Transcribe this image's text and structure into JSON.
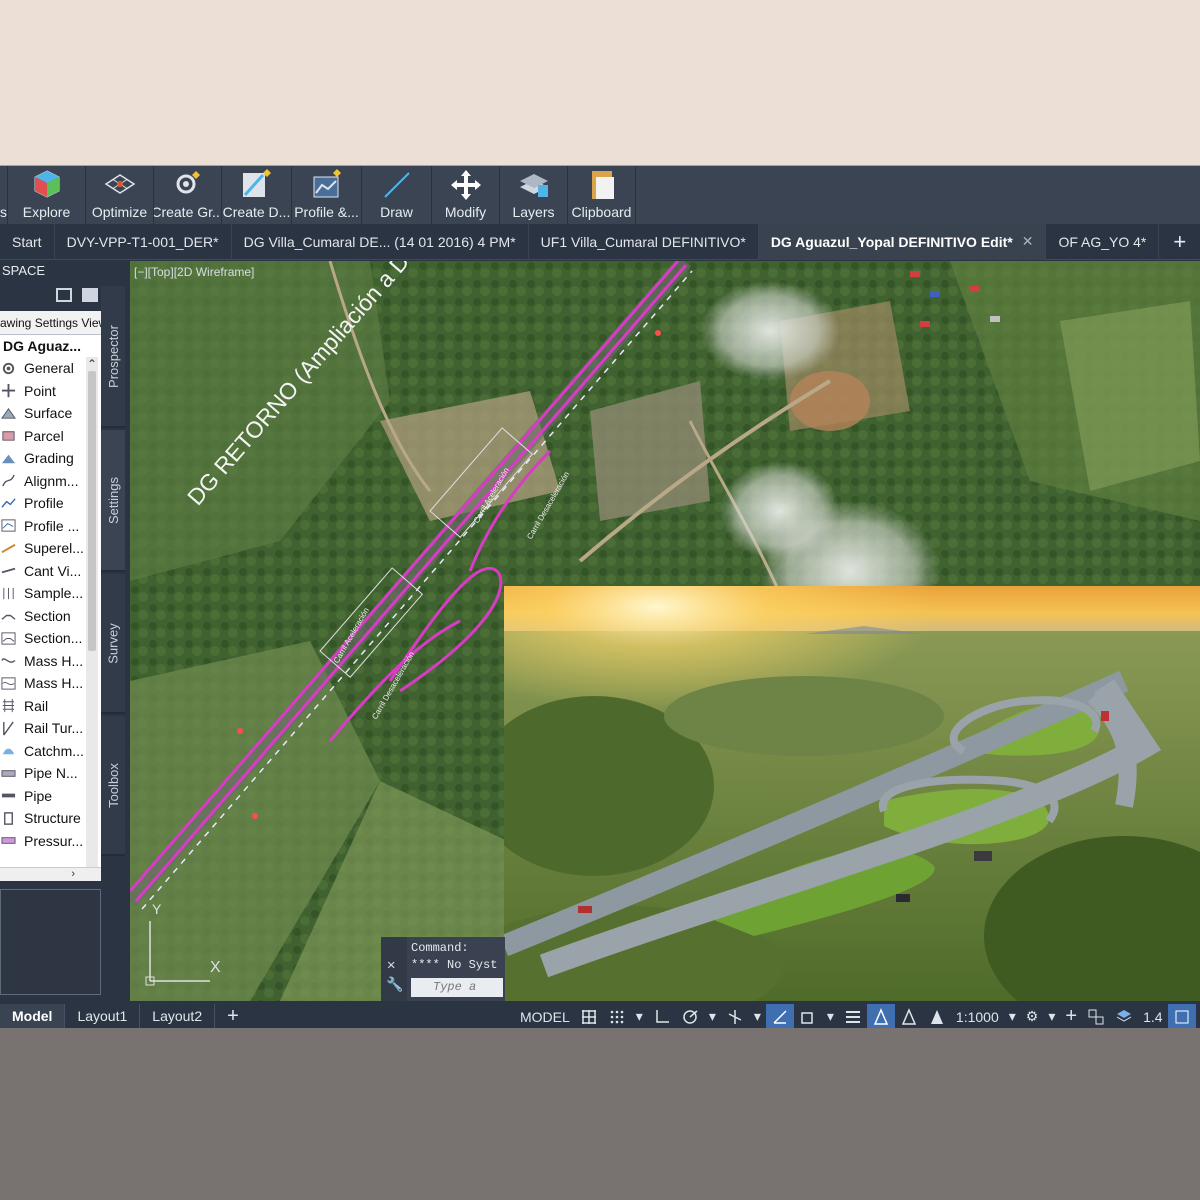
{
  "ribbon": {
    "buttons": [
      {
        "label": "s",
        "icon": "panel-icon"
      },
      {
        "label": "Explore",
        "icon": "cube-icon"
      },
      {
        "label": "Optimize",
        "icon": "grid-optimize-icon"
      },
      {
        "label": "Create Gr...",
        "icon": "grading-create-icon"
      },
      {
        "label": "Create D...",
        "icon": "design-create-icon"
      },
      {
        "label": "Profile &...",
        "icon": "profile-icon"
      },
      {
        "label": "Draw",
        "icon": "line-draw-icon"
      },
      {
        "label": "Modify",
        "icon": "move-arrows-icon"
      },
      {
        "label": "Layers",
        "icon": "layers-icon"
      },
      {
        "label": "Clipboard",
        "icon": "clipboard-icon"
      }
    ]
  },
  "tabs": [
    {
      "label": "Start",
      "active": false
    },
    {
      "label": "DVY-VPP-T1-001_DER*",
      "active": false
    },
    {
      "label": "DG Villa_Cumaral DE... (14 01 2016) 4 PM*",
      "active": false
    },
    {
      "label": "UF1 Villa_Cumaral DEFINITIVO*",
      "active": false
    },
    {
      "label": "DG Aguazul_Yopal DEFINITIVO Edit*",
      "active": true
    },
    {
      "label": "OF AG_YO 4*",
      "active": false
    }
  ],
  "tab_close": "✕",
  "tab_add": "+",
  "palette": {
    "header": "SPACE",
    "settings_label": "awing Settings View",
    "root": "DG Aguaz...",
    "items": [
      {
        "label": "General",
        "icon": "gear-icon"
      },
      {
        "label": "Point",
        "icon": "point-icon"
      },
      {
        "label": "Surface",
        "icon": "surface-icon"
      },
      {
        "label": "Parcel",
        "icon": "parcel-icon"
      },
      {
        "label": "Grading",
        "icon": "grading-icon"
      },
      {
        "label": "Alignm...",
        "icon": "alignment-icon"
      },
      {
        "label": "Profile",
        "icon": "profile-icon"
      },
      {
        "label": "Profile ...",
        "icon": "profile-view-icon"
      },
      {
        "label": "Superel...",
        "icon": "superelevation-icon"
      },
      {
        "label": "Cant Vi...",
        "icon": "cant-view-icon"
      },
      {
        "label": "Sample...",
        "icon": "sample-line-icon"
      },
      {
        "label": "Section",
        "icon": "section-icon"
      },
      {
        "label": "Section...",
        "icon": "section-view-icon"
      },
      {
        "label": "Mass H...",
        "icon": "mass-haul-icon"
      },
      {
        "label": "Mass H...",
        "icon": "mass-haul-view-icon"
      },
      {
        "label": "Rail",
        "icon": "rail-icon"
      },
      {
        "label": "Rail Tur...",
        "icon": "rail-turnout-icon"
      },
      {
        "label": "Catchm...",
        "icon": "catchment-icon"
      },
      {
        "label": "Pipe N...",
        "icon": "pipe-network-icon"
      },
      {
        "label": "Pipe",
        "icon": "pipe-icon"
      },
      {
        "label": "Structure",
        "icon": "structure-icon"
      },
      {
        "label": "Pressur...",
        "icon": "pressure-icon"
      }
    ],
    "scroll_right": "›"
  },
  "side_tabs": [
    "Prospector",
    "Settings",
    "Survey",
    "Toolbox"
  ],
  "viewport": {
    "label": "[−][Top][2D Wireframe]",
    "annotation": "DG RETORNO (Ampliación a Derecha)",
    "ucs_y": "Y",
    "ucs_x": "X",
    "small_labels": [
      "Carril Aceleración",
      "Carril Desaceleración",
      "Carril Aceleración",
      "Carril Desaceleración"
    ]
  },
  "command": {
    "line1": "Command:",
    "line2": "**** No Syst",
    "placeholder": "Type a"
  },
  "status": {
    "tabs": [
      {
        "label": "Model",
        "active": true
      },
      {
        "label": "Layout1",
        "active": false
      },
      {
        "label": "Layout2",
        "active": false
      }
    ],
    "add": "+",
    "model": "MODEL",
    "scale": "1:1000",
    "zoom": "1.4"
  },
  "colors": {
    "accent": "#3f6fb0",
    "alignment": "#d83cc4",
    "border_top": "#d89a3a"
  }
}
